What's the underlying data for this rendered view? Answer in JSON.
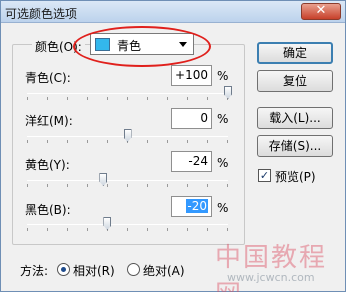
{
  "window": {
    "title": "可选颜色选项",
    "close_glyph": "✕"
  },
  "colors": {
    "label": "颜色(O):",
    "selected": "青色",
    "swatch_color": "#33b7ec",
    "highlight_color": "#e0201c"
  },
  "rows": [
    {
      "label": "青色(C):",
      "value": "+100",
      "unit": "%",
      "level": 1.0
    },
    {
      "label": "洋红(M):",
      "value": "0",
      "unit": "%",
      "level": 0.5
    },
    {
      "label": "黄色(Y):",
      "value": "-24",
      "unit": "%",
      "level": 0.38
    },
    {
      "label": "黑色(B):",
      "value": "-20",
      "unit": "%",
      "level": 0.4
    }
  ],
  "buttons": {
    "ok": "确定",
    "reset": "复位",
    "load": "载入(L)...",
    "save": "存储(S)..."
  },
  "preview": {
    "label": "预览(P)",
    "checked": true,
    "check_glyph": "✓"
  },
  "method": {
    "label": "方法:",
    "relative": "相对(R)",
    "absolute": "绝对(A)",
    "selected": "relative"
  },
  "watermark": {
    "text": "中国教程网",
    "url": "www.jcwcn.com"
  }
}
